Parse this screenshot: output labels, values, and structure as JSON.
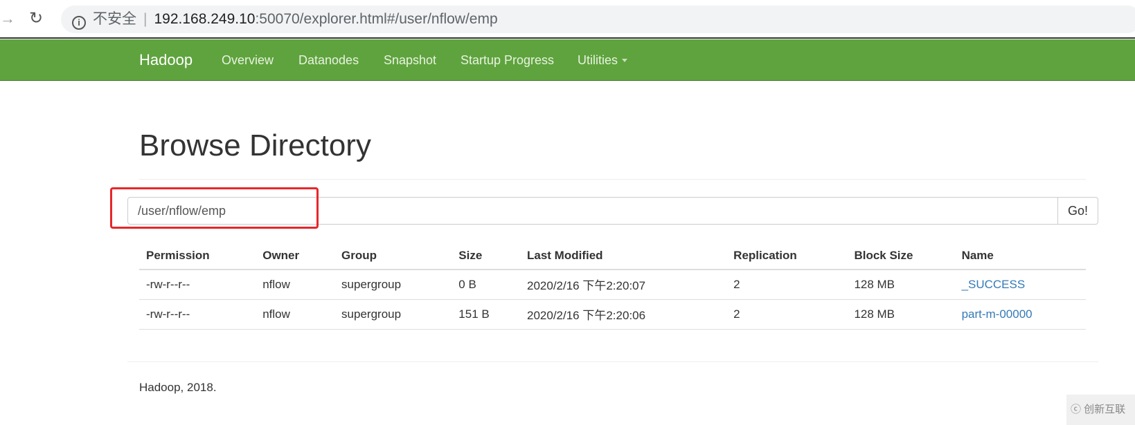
{
  "browser": {
    "url_host": "192.168.249.10",
    "url_rest": ":50070/explorer.html#/user/nflow/emp",
    "security_label": "不安全"
  },
  "navbar": {
    "brand": "Hadoop",
    "items": [
      "Overview",
      "Datanodes",
      "Snapshot",
      "Startup Progress",
      "Utilities"
    ]
  },
  "page": {
    "title": "Browse Directory",
    "path_value": "/user/nflow/emp",
    "go_label": "Go!"
  },
  "table": {
    "headers": [
      "Permission",
      "Owner",
      "Group",
      "Size",
      "Last Modified",
      "Replication",
      "Block Size",
      "Name"
    ],
    "rows": [
      [
        "-rw-r--r--",
        "nflow",
        "supergroup",
        "0 B",
        "2020/2/16 下午2:20:07",
        "2",
        "128 MB",
        "_SUCCESS"
      ],
      [
        "-rw-r--r--",
        "nflow",
        "supergroup",
        "151 B",
        "2020/2/16 下午2:20:06",
        "2",
        "128 MB",
        "part-m-00000"
      ]
    ]
  },
  "footer": {
    "text": "Hadoop, 2018."
  },
  "watermark": {
    "text": "创新互联"
  }
}
